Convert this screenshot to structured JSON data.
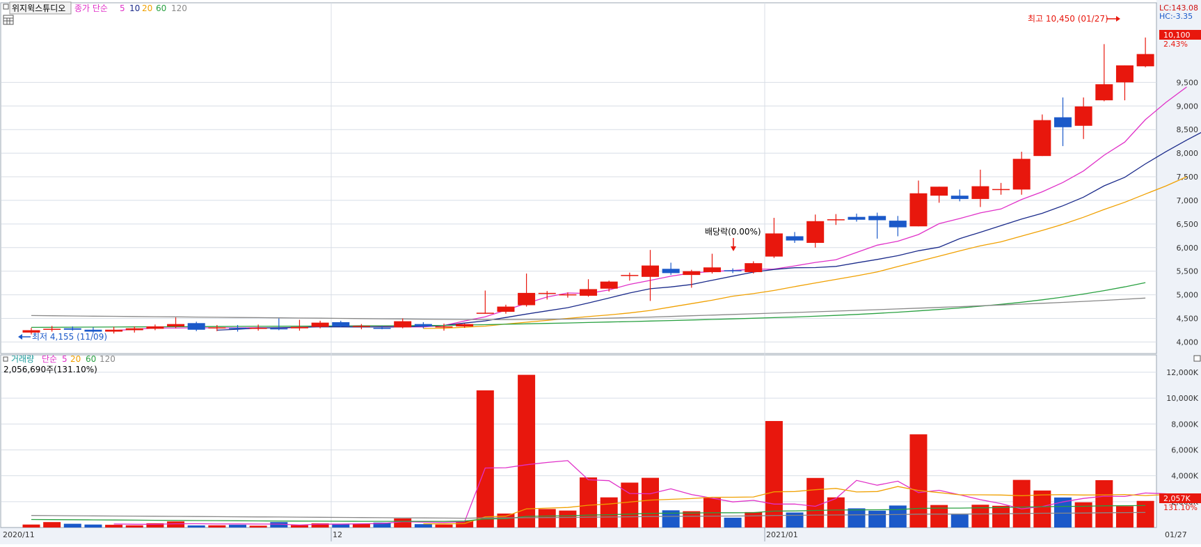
{
  "header": {
    "stock_name": "위지윅스튜디오",
    "price_legend": {
      "label": "종가 단순",
      "periods": [
        "5",
        "10",
        "20",
        "60",
        "120"
      ]
    },
    "volume_legend": {
      "label": "거래량",
      "ma_label": "단순",
      "periods": [
        "5",
        "20",
        "60",
        "120"
      ]
    },
    "volume_current": "2,056,690주(131.10%)",
    "lc_label": "LC:143.08",
    "hc_label": "HC:-3.35"
  },
  "annotations": {
    "high": "최고 10,450 (01/27)",
    "low": "최저 4,155 (11/09)",
    "dividend": "배당락(0.00%)"
  },
  "price_badge": {
    "price": "10,100",
    "change": "2.43%"
  },
  "volume_badge": {
    "volume": "2,057K",
    "ratio": "131.10%"
  },
  "x_labels": {
    "start": "2020/11",
    "dec": "12",
    "jan": "2021/01",
    "right": "01/27"
  },
  "colors": {
    "up": "#e8170d",
    "down": "#1b59c9",
    "ma5": "#e030c8",
    "ma10": "#1a2a8a",
    "ma20": "#f0a000",
    "ma60": "#28a040",
    "ma120": "#888888",
    "grid": "#d8dee6",
    "axis_bg": "#eef2f8"
  },
  "chart_data": [
    {
      "type": "candlestick",
      "title": "위지윅스튜디오",
      "ylim": [
        3800,
        10950
      ],
      "y_ticks": [
        "4,000",
        "4,500",
        "5,000",
        "5,500",
        "6,000",
        "6,500",
        "7,000",
        "7,500",
        "8,000",
        "8,500",
        "9,000",
        "9,500"
      ],
      "candles": [
        [
          4200,
          4300,
          4160,
          4250
        ],
        [
          4270,
          4340,
          4220,
          4280
        ],
        [
          4290,
          4330,
          4240,
          4260
        ],
        [
          4260,
          4310,
          4190,
          4220
        ],
        [
          4220,
          4320,
          4180,
          4260
        ],
        [
          4250,
          4330,
          4200,
          4290
        ],
        [
          4280,
          4370,
          4250,
          4330
        ],
        [
          4330,
          4520,
          4290,
          4380
        ],
        [
          4400,
          4430,
          4230,
          4260
        ],
        [
          4290,
          4360,
          4230,
          4310
        ],
        [
          4300,
          4360,
          4220,
          4280
        ],
        [
          4290,
          4370,
          4240,
          4300
        ],
        [
          4290,
          4500,
          4250,
          4280
        ],
        [
          4290,
          4470,
          4240,
          4320
        ],
        [
          4320,
          4450,
          4290,
          4410
        ],
        [
          4420,
          4450,
          4310,
          4330
        ],
        [
          4320,
          4380,
          4270,
          4340
        ],
        [
          4300,
          4340,
          4270,
          4290
        ],
        [
          4310,
          4500,
          4290,
          4440
        ],
        [
          4380,
          4420,
          4290,
          4330
        ],
        [
          4310,
          4390,
          4240,
          4330
        ],
        [
          4330,
          4390,
          4300,
          4380
        ],
        [
          4610,
          5090,
          4600,
          4620
        ],
        [
          4640,
          4790,
          4600,
          4750
        ],
        [
          4780,
          5450,
          4750,
          5040
        ],
        [
          5020,
          5080,
          4900,
          5040
        ],
        [
          4990,
          5050,
          4940,
          5010
        ],
        [
          4980,
          5330,
          4960,
          5120
        ],
        [
          5130,
          5300,
          5070,
          5280
        ],
        [
          5400,
          5470,
          5300,
          5420
        ],
        [
          5380,
          5950,
          4870,
          5620
        ],
        [
          5550,
          5680,
          5420,
          5460
        ],
        [
          5420,
          5530,
          5150,
          5500
        ],
        [
          5480,
          5870,
          5450,
          5580
        ],
        [
          5520,
          5560,
          5460,
          5510
        ],
        [
          5480,
          5710,
          5450,
          5670
        ],
        [
          5810,
          6630,
          5780,
          6300
        ],
        [
          6240,
          6330,
          6100,
          6150
        ],
        [
          6100,
          6700,
          6000,
          6560
        ],
        [
          6580,
          6710,
          6480,
          6600
        ],
        [
          6650,
          6720,
          6550,
          6590
        ],
        [
          6670,
          6740,
          6190,
          6580
        ],
        [
          6570,
          6670,
          6240,
          6430
        ],
        [
          6450,
          7420,
          6450,
          7150
        ],
        [
          7100,
          7290,
          6950,
          7290
        ],
        [
          7100,
          7230,
          6980,
          7030
        ],
        [
          7030,
          7650,
          6860,
          7300
        ],
        [
          7240,
          7370,
          7120,
          7240
        ],
        [
          7230,
          8030,
          7120,
          7880
        ],
        [
          7940,
          8820,
          7940,
          8700
        ],
        [
          8760,
          9180,
          8150,
          8550
        ],
        [
          8580,
          9180,
          8300,
          8990
        ],
        [
          9120,
          10310,
          9100,
          9460
        ],
        [
          9500,
          9860,
          9120,
          9860
        ],
        [
          9840,
          10450,
          9820,
          10100
        ]
      ],
      "ma": [
        {
          "name": "5",
          "start": 4,
          "values": [
            4244,
            4268,
            4295,
            4296,
            4301,
            4300,
            4300,
            4302,
            4299,
            4306,
            4328,
            4338,
            4346,
            4332,
            4320,
            4320,
            4352,
            4444,
            4533,
            4675,
            4818,
            4955,
            5039,
            5028,
            5103,
            5221,
            5305,
            5393,
            5461,
            5492,
            5515,
            5543,
            5545,
            5612,
            5686,
            5741,
            5896,
            6051,
            6135,
            6276,
            6506,
            6616,
            6735,
            6818,
            7019,
            7182,
            7379,
            7622,
            7958,
            8235,
            8711,
            9078,
            9402
          ]
        },
        {
          "name": "10",
          "start": 9,
          "values": [
            4251,
            4270,
            4297,
            4303,
            4311,
            4322,
            4321,
            4317,
            4318,
            4319,
            4335,
            4349,
            4401,
            4447,
            4520,
            4591,
            4660,
            4728,
            4826,
            4932,
            5039,
            5129,
            5166,
            5218,
            5308,
            5395,
            5480,
            5537,
            5573,
            5576,
            5602,
            5676,
            5749,
            5828,
            5933,
            6009,
            6189,
            6325,
            6466,
            6604,
            6726,
            6886,
            7068,
            7309,
            7489,
            7773,
            8034,
            8277,
            8506
          ]
        },
        {
          "name": "20",
          "start": 19,
          "values": [
            4286,
            4293,
            4313,
            4337,
            4381,
            4419,
            4457,
            4500,
            4539,
            4574,
            4615,
            4669,
            4740,
            4813,
            4885,
            4970,
            5025,
            5092,
            5172,
            5251,
            5326,
            5401,
            5483,
            5599,
            5707,
            5818,
            5930,
            6038,
            6122,
            6244,
            6363,
            6493,
            6643,
            6808,
            6960,
            7134,
            7307,
            7500
          ]
        },
        {
          "name": "60",
          "start": 0,
          "values": [
            4310,
            4312,
            4314,
            4316,
            4318,
            4320,
            4322,
            4324,
            4326,
            4328,
            4330,
            4332,
            4334,
            4336,
            4338,
            4340,
            4342,
            4344,
            4346,
            4348,
            4352,
            4360,
            4368,
            4376,
            4385,
            4394,
            4403,
            4413,
            4423,
            4433,
            4444,
            4455,
            4466,
            4478,
            4490,
            4503,
            4516,
            4530,
            4546,
            4564,
            4584,
            4606,
            4631,
            4659,
            4689,
            4722,
            4758,
            4798,
            4843,
            4894,
            4951,
            5016,
            5088,
            5168,
            5258
          ]
        },
        {
          "name": "120",
          "start": 0,
          "values": [
            4560,
            4556,
            4552,
            4548,
            4544,
            4540,
            4536,
            4532,
            4528,
            4524,
            4520,
            4516,
            4512,
            4508,
            4504,
            4500,
            4496,
            4492,
            4488,
            4484,
            4480,
            4476,
            4474,
            4474,
            4476,
            4480,
            4486,
            4494,
            4504,
            4516,
            4528,
            4542,
            4556,
            4570,
            4584,
            4598,
            4612,
            4626,
            4640,
            4655,
            4670,
            4685,
            4701,
            4717,
            4733,
            4750,
            4767,
            4784,
            4802,
            4820,
            4840,
            4860,
            4882,
            4905,
            4930
          ]
        }
      ]
    },
    {
      "type": "bar",
      "title": "거래량",
      "ylim": [
        0,
        12800
      ],
      "y_ticks": [
        "2,000K",
        "4,000K",
        "6,000K",
        "8,000K",
        "10,000K",
        "12,000K"
      ],
      "unit": "K",
      "volumes": [
        230,
        420,
        290,
        230,
        210,
        170,
        330,
        470,
        160,
        170,
        210,
        140,
        420,
        180,
        320,
        300,
        280,
        380,
        700,
        260,
        230,
        500,
        10600,
        1080,
        11800,
        1430,
        1310,
        3870,
        2330,
        3470,
        3840,
        1330,
        1260,
        2290,
        760,
        1190,
        8230,
        1160,
        3830,
        2330,
        1480,
        1300,
        1700,
        7200,
        1740,
        1010,
        1760,
        1680,
        3680,
        2860,
        2320,
        1950,
        3660,
        1650,
        2057
      ],
      "ma": [
        {
          "name": "5",
          "start": 4,
          "values": [
            276,
            254,
            250,
            289,
            296,
            272,
            281,
            268,
            261,
            194,
            264,
            257,
            290,
            306,
            450,
            422,
            392,
            440,
            4600,
            4620,
            4850,
            5030,
            5170,
            3690,
            3620,
            2630,
            2610,
            2990,
            2550,
            2270,
            1980,
            2100,
            1810,
            1810,
            1640,
            2240,
            3640,
            3270,
            3580,
            2700,
            2880,
            2530,
            2150,
            1850,
            1440,
            1620,
            1980,
            2250,
            2420,
            2400,
            2670,
            2610,
            2380
          ]
        },
        {
          "name": "20",
          "start": 19,
          "values": [
            285,
            283,
            300,
            830,
            870,
            1440,
            1500,
            1550,
            1720,
            1820,
            1970,
            2120,
            2180,
            2240,
            2340,
            2340,
            2360,
            2760,
            2780,
            2920,
            3020,
            2750,
            2780,
            3170,
            2860,
            2700,
            2530,
            2530,
            2510,
            2460,
            2520,
            2540,
            2510,
            2520,
            2550,
            2470,
            2550
          ]
        },
        {
          "name": "60",
          "start": 0,
          "values": [
            620,
            610,
            600,
            590,
            580,
            570,
            560,
            550,
            540,
            530,
            520,
            510,
            500,
            495,
            490,
            485,
            480,
            480,
            480,
            480,
            480,
            500,
            660,
            680,
            860,
            890,
            910,
            960,
            990,
            1040,
            1090,
            1110,
            1120,
            1140,
            1140,
            1150,
            1270,
            1280,
            1320,
            1350,
            1360,
            1370,
            1380,
            1480,
            1500,
            1500,
            1520,
            1540,
            1580,
            1610,
            1630,
            1640,
            1680,
            1690,
            1700
          ]
        },
        {
          "name": "120",
          "start": 0,
          "values": [
            930,
            920,
            910,
            900,
            890,
            880,
            870,
            860,
            850,
            840,
            830,
            820,
            810,
            800,
            790,
            780,
            770,
            760,
            750,
            740,
            730,
            720,
            740,
            740,
            760,
            770,
            780,
            800,
            810,
            830,
            850,
            860,
            870,
            880,
            890,
            900,
            930,
            940,
            960,
            970,
            980,
            990,
            1000,
            1030,
            1040,
            1040,
            1050,
            1060,
            1080,
            1100,
            1110,
            1120,
            1140,
            1150,
            1160
          ]
        }
      ]
    }
  ]
}
